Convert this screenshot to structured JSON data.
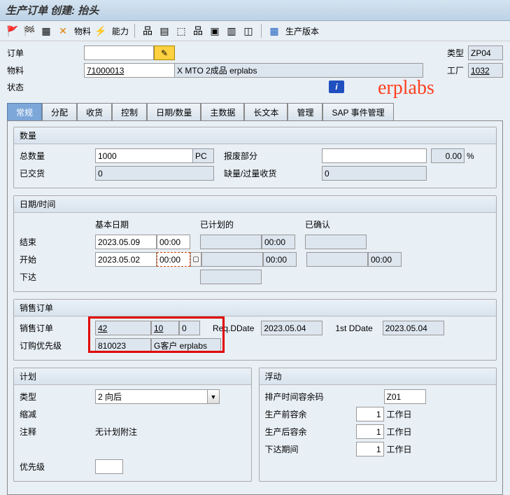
{
  "title": "生产订单 创建: 抬头",
  "toolbar": {
    "material": "物料",
    "capacity": "能力",
    "prodver": "生产版本"
  },
  "header": {
    "order_label": "订单",
    "order_val": "",
    "material_label": "物料",
    "material_val": "71000013",
    "material_desc": "X MTO 2成品 erplabs",
    "status_label": "状态",
    "type_label": "类型",
    "type_val": "ZP04",
    "plant_label": "工厂",
    "plant_val": "1032"
  },
  "watermark": "erplabs",
  "tabs": [
    "常规",
    "分配",
    "收货",
    "控制",
    "日期/数量",
    "主数据",
    "长文本",
    "管理",
    "SAP 事件管理"
  ],
  "qty": {
    "title": "数量",
    "total_label": "总数量",
    "total_val": "1000",
    "uom": "PC",
    "scrap_label": "报废部分",
    "scrap_val": "",
    "scrap_pct": "0.00",
    "delivered_label": "已交货",
    "delivered_val": "0",
    "short_label": "缺量/过量收货",
    "short_val": "0"
  },
  "dates": {
    "title": "日期/时间",
    "col_basic": "基本日期",
    "col_plan": "已计划的",
    "col_conf": "已确认",
    "end_label": "结束",
    "end_date": "2023.05.09",
    "end_time": "00:00",
    "start_label": "开始",
    "start_date": "2023.05.02",
    "start_time": "00:00",
    "release_label": "下达",
    "plan_time": "00:00",
    "plan_time2": "00:00",
    "conf_time": "00:00"
  },
  "sales": {
    "title": "销售订单",
    "so_label": "销售订单",
    "so": "42",
    "item": "10",
    "sched": "0",
    "req_label": "Req.DDate",
    "req_date": "2023.05.04",
    "first_label": "1st DDate",
    "first_date": "2023.05.04",
    "prio_label": "订购优先级",
    "prio_val": "810023",
    "cust": "G客户 erplabs"
  },
  "plan": {
    "title": "计划",
    "type_label": "类型",
    "type_val": "2 向后",
    "red_label": "缩减",
    "note_label": "注释",
    "note_val": "无计划附注",
    "prio_label": "优先级"
  },
  "float": {
    "title": "浮动",
    "key_label": "排产时间容余码",
    "key_val": "Z01",
    "before_label": "生产前容余",
    "before_val": "1",
    "wd": "工作日",
    "after_label": "生产后容余",
    "after_val": "1",
    "rel_label": "下达期间",
    "rel_val": "1"
  },
  "pct": "%"
}
